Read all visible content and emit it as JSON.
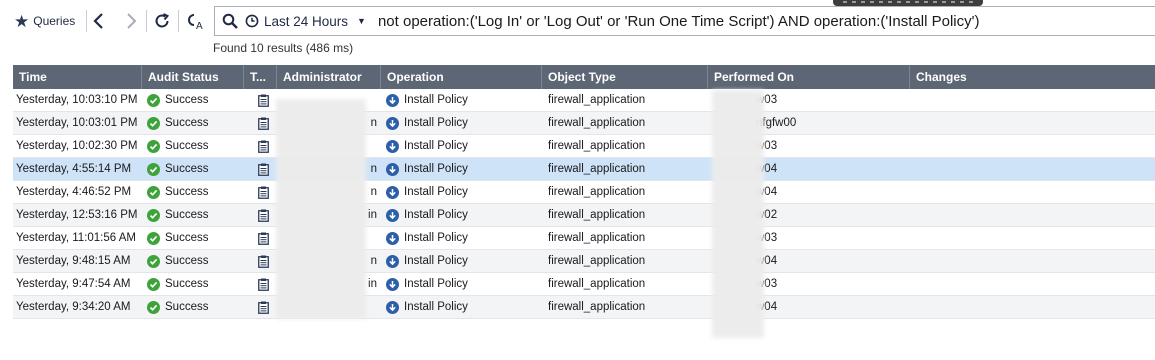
{
  "toolbar": {
    "queries_label": "Queries",
    "search": {
      "time_range": "Last 24 Hours",
      "query": "not operation:('Log In' or 'Log Out' or 'Run One Time Script') AND operation:('Install Policy')"
    }
  },
  "results_summary": "Found 10 results (486 ms)",
  "columns": {
    "time": "Time",
    "audit_status": "Audit Status",
    "type": "T...",
    "administrator": "Administrator",
    "operation": "Operation",
    "object_type": "Object Type",
    "performed_on": "Performed On",
    "changes": "Changes"
  },
  "rows": [
    {
      "time": "Yesterday, 10:03:10 PM",
      "status": "Success",
      "admin": "",
      "operation": "Install Policy",
      "object_type": "firewall_application",
      "performed_on": "w03"
    },
    {
      "time": "Yesterday, 10:03:01 PM",
      "status": "Success",
      "admin": "n",
      "operation": "Install Policy",
      "object_type": "firewall_application",
      "performed_on": "nfgfw00"
    },
    {
      "time": "Yesterday, 10:02:30 PM",
      "status": "Success",
      "admin": "",
      "operation": "Install Policy",
      "object_type": "firewall_application",
      "performed_on": "w03"
    },
    {
      "time": "Yesterday, 4:55:14 PM",
      "status": "Success",
      "admin": "n",
      "operation": "Install Policy",
      "object_type": "firewall_application",
      "performed_on": "w04"
    },
    {
      "time": "Yesterday, 4:46:52 PM",
      "status": "Success",
      "admin": "n",
      "operation": "Install Policy",
      "object_type": "firewall_application",
      "performed_on": "w04"
    },
    {
      "time": "Yesterday, 12:53:16 PM",
      "status": "Success",
      "admin": "in",
      "operation": "Install Policy",
      "object_type": "firewall_application",
      "performed_on": "w02"
    },
    {
      "time": "Yesterday, 11:01:56 AM",
      "status": "Success",
      "admin": "",
      "operation": "Install Policy",
      "object_type": "firewall_application",
      "performed_on": "w03"
    },
    {
      "time": "Yesterday, 9:48:15 AM",
      "status": "Success",
      "admin": "n",
      "operation": "Install Policy",
      "object_type": "firewall_application",
      "performed_on": "w04"
    },
    {
      "time": "Yesterday, 9:47:54 AM",
      "status": "Success",
      "admin": "in",
      "operation": "Install Policy",
      "object_type": "firewall_application",
      "performed_on": "w03"
    },
    {
      "time": "Yesterday, 9:34:20 AM",
      "status": "Success",
      "admin": "",
      "operation": "Install Policy",
      "object_type": "firewall_application",
      "performed_on": "w04"
    }
  ],
  "selected_row_index": 3,
  "colors": {
    "header_bg": "#5c6675",
    "selected_row_bg": "#cfe3f8",
    "success_green": "#3da33a",
    "operation_blue": "#2d5ea8"
  }
}
